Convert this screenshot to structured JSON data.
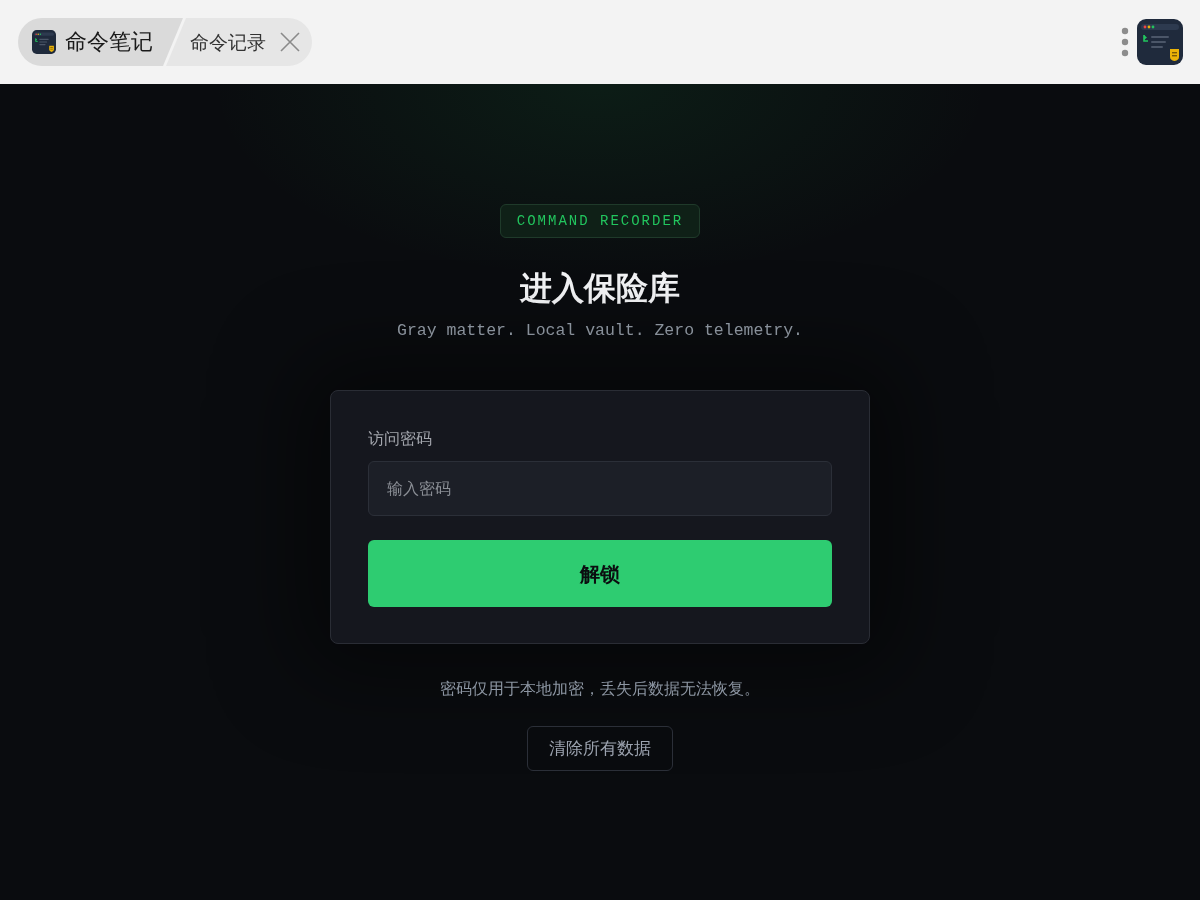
{
  "header": {
    "tabs": [
      {
        "kind": "app",
        "label": "命令笔记"
      },
      {
        "kind": "page",
        "label": "命令记录"
      }
    ]
  },
  "badge": "COMMAND RECORDER",
  "title": "进入保险库",
  "subtitle": "Gray matter. Local vault. Zero telemetry.",
  "form": {
    "label": "访问密码",
    "password": {
      "placeholder": "输入密码"
    },
    "submit": "解锁"
  },
  "note": "密码仅用于本地加密，丢失后数据无法恢复。",
  "clear_button": "清除所有数据"
}
